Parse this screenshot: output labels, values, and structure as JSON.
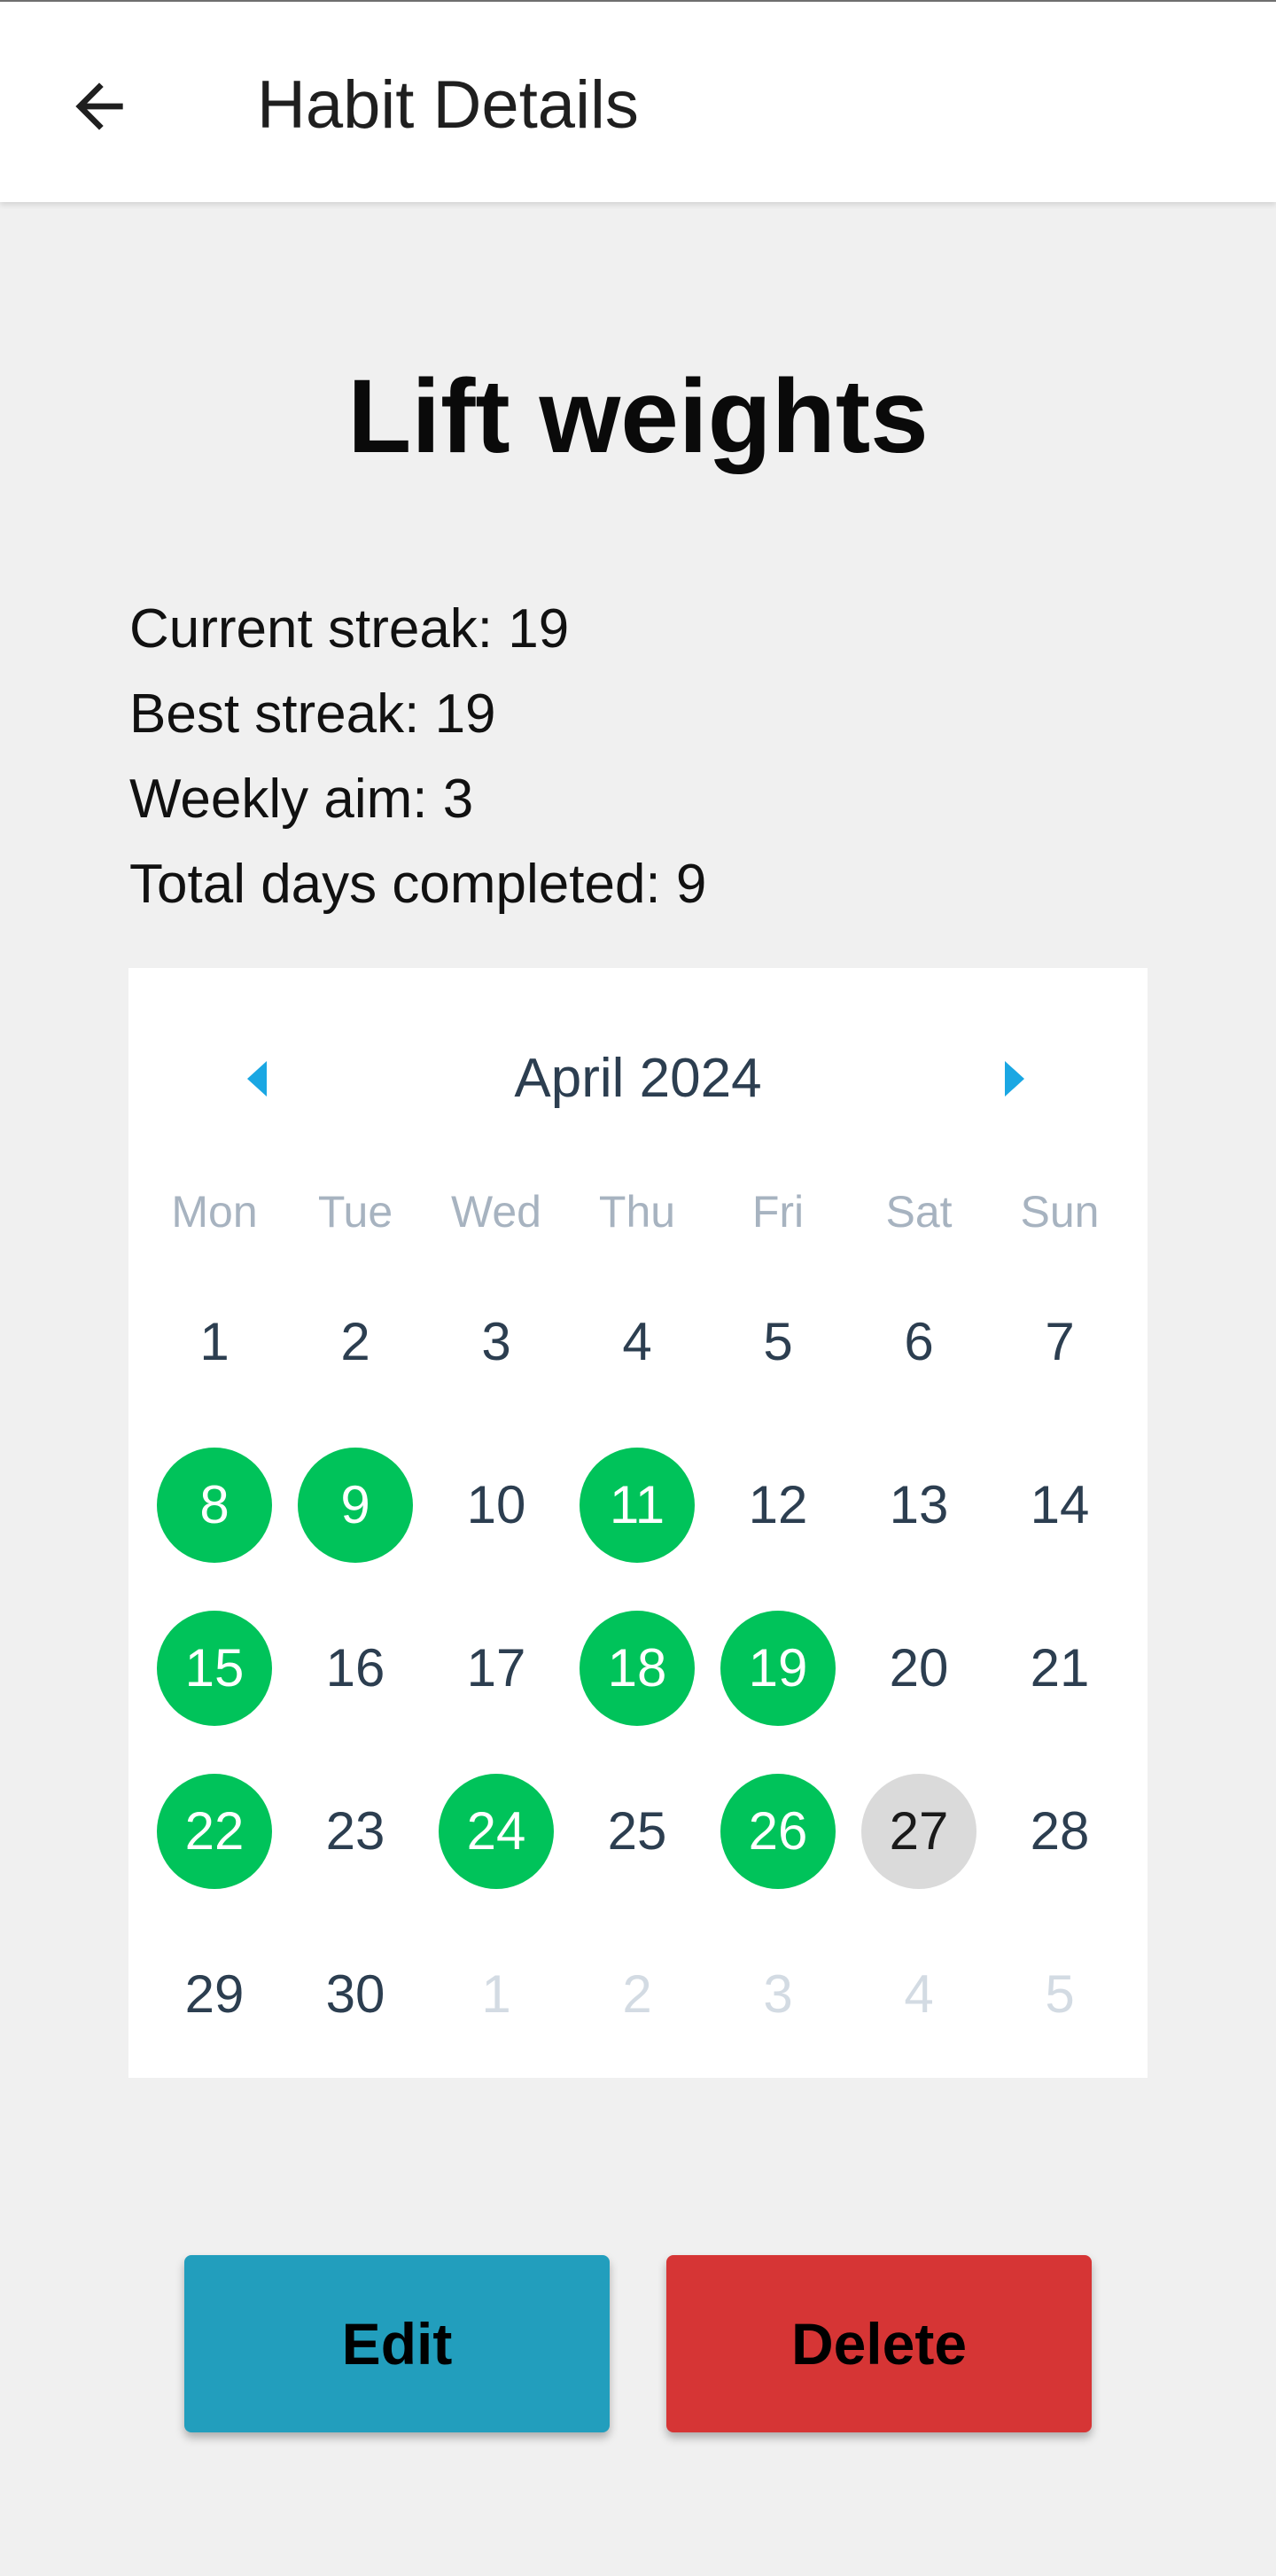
{
  "header": {
    "title": "Habit Details",
    "back_icon": "arrow-left-icon"
  },
  "habit": {
    "name": "Lift weights"
  },
  "stats": {
    "current_streak": "Current streak: 19",
    "best_streak": "Best streak: 19",
    "weekly_aim": "Weekly aim: 3",
    "total_days": "Total days completed: 9"
  },
  "calendar": {
    "month_label": "April 2024",
    "prev_icon": "triangle-left-icon",
    "next_icon": "triangle-right-icon",
    "weekdays": [
      "Mon",
      "Tue",
      "Wed",
      "Thu",
      "Fri",
      "Sat",
      "Sun"
    ],
    "weeks": [
      [
        {
          "d": "1",
          "s": "normal"
        },
        {
          "d": "2",
          "s": "normal"
        },
        {
          "d": "3",
          "s": "normal"
        },
        {
          "d": "4",
          "s": "normal"
        },
        {
          "d": "5",
          "s": "normal"
        },
        {
          "d": "6",
          "s": "normal"
        },
        {
          "d": "7",
          "s": "normal"
        }
      ],
      [
        {
          "d": "8",
          "s": "done"
        },
        {
          "d": "9",
          "s": "done"
        },
        {
          "d": "10",
          "s": "normal"
        },
        {
          "d": "11",
          "s": "done"
        },
        {
          "d": "12",
          "s": "normal"
        },
        {
          "d": "13",
          "s": "normal"
        },
        {
          "d": "14",
          "s": "normal"
        }
      ],
      [
        {
          "d": "15",
          "s": "done"
        },
        {
          "d": "16",
          "s": "normal"
        },
        {
          "d": "17",
          "s": "normal"
        },
        {
          "d": "18",
          "s": "done"
        },
        {
          "d": "19",
          "s": "done"
        },
        {
          "d": "20",
          "s": "normal"
        },
        {
          "d": "21",
          "s": "normal"
        }
      ],
      [
        {
          "d": "22",
          "s": "done"
        },
        {
          "d": "23",
          "s": "normal"
        },
        {
          "d": "24",
          "s": "done"
        },
        {
          "d": "25",
          "s": "normal"
        },
        {
          "d": "26",
          "s": "done"
        },
        {
          "d": "27",
          "s": "today"
        },
        {
          "d": "28",
          "s": "normal"
        }
      ],
      [
        {
          "d": "29",
          "s": "normal"
        },
        {
          "d": "30",
          "s": "normal"
        },
        {
          "d": "1",
          "s": "other"
        },
        {
          "d": "2",
          "s": "other"
        },
        {
          "d": "3",
          "s": "other"
        },
        {
          "d": "4",
          "s": "other"
        },
        {
          "d": "5",
          "s": "other"
        }
      ]
    ]
  },
  "actions": {
    "edit_label": "Edit",
    "delete_label": "Delete"
  },
  "colors": {
    "completed": "#00c35a",
    "today": "#dadada",
    "edit": "#229ebd",
    "delete": "#d63535",
    "accent_arrows": "#1aa7e3"
  }
}
